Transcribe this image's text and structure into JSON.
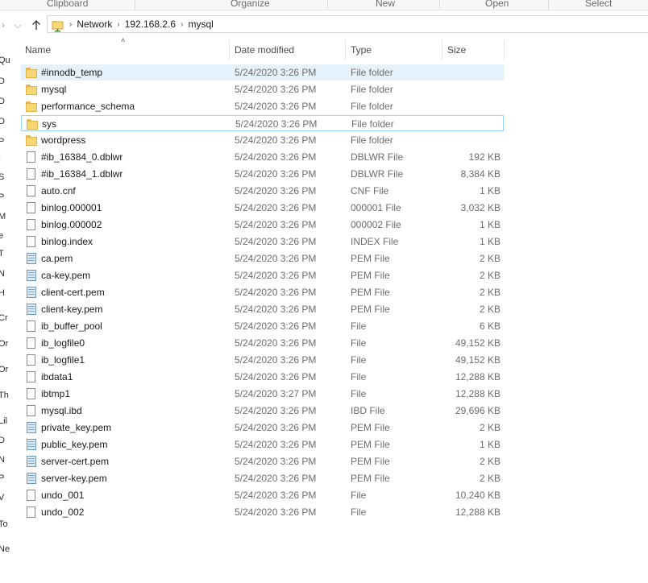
{
  "ribbon": {
    "groups": [
      "Clipboard",
      "Organize",
      "New",
      "Open",
      "Select"
    ]
  },
  "address": {
    "segments": [
      "Network",
      "192.168.2.6",
      "mysql"
    ]
  },
  "nav_pane": {
    "fragments": [
      "Qu",
      "D",
      "D",
      "D",
      "P",
      "I",
      "S",
      "P",
      "M",
      "e",
      "T",
      "N",
      "H",
      "Cr",
      "Or",
      "Or",
      "Th",
      "Lil",
      "D",
      "N",
      "P",
      "V",
      "To",
      "Ne"
    ]
  },
  "columns": {
    "name": "Name",
    "date": "Date modified",
    "type": "Type",
    "size": "Size"
  },
  "files": [
    {
      "name": "#innodb_temp",
      "date": "5/24/2020 3:26 PM",
      "type": "File folder",
      "size": "",
      "icon": "folder-icon"
    },
    {
      "name": "mysql",
      "date": "5/24/2020 3:26 PM",
      "type": "File folder",
      "size": "",
      "icon": "folder-icon"
    },
    {
      "name": "performance_schema",
      "date": "5/24/2020 3:26 PM",
      "type": "File folder",
      "size": "",
      "icon": "folder-icon"
    },
    {
      "name": "sys",
      "date": "5/24/2020 3:26 PM",
      "type": "File folder",
      "size": "",
      "icon": "folder-icon"
    },
    {
      "name": "wordpress",
      "date": "5/24/2020 3:26 PM",
      "type": "File folder",
      "size": "",
      "icon": "folder-icon"
    },
    {
      "name": "#ib_16384_0.dblwr",
      "date": "5/24/2020 3:26 PM",
      "type": "DBLWR File",
      "size": "192 KB",
      "icon": "file-icon"
    },
    {
      "name": "#ib_16384_1.dblwr",
      "date": "5/24/2020 3:26 PM",
      "type": "DBLWR File",
      "size": "8,384 KB",
      "icon": "file-icon"
    },
    {
      "name": "auto.cnf",
      "date": "5/24/2020 3:26 PM",
      "type": "CNF File",
      "size": "1 KB",
      "icon": "file-icon"
    },
    {
      "name": "binlog.000001",
      "date": "5/24/2020 3:26 PM",
      "type": "000001 File",
      "size": "3,032 KB",
      "icon": "file-icon"
    },
    {
      "name": "binlog.000002",
      "date": "5/24/2020 3:26 PM",
      "type": "000002 File",
      "size": "1 KB",
      "icon": "file-icon"
    },
    {
      "name": "binlog.index",
      "date": "5/24/2020 3:26 PM",
      "type": "INDEX File",
      "size": "1 KB",
      "icon": "file-icon"
    },
    {
      "name": "ca.pem",
      "date": "5/24/2020 3:26 PM",
      "type": "PEM File",
      "size": "2 KB",
      "icon": "certificate-icon"
    },
    {
      "name": "ca-key.pem",
      "date": "5/24/2020 3:26 PM",
      "type": "PEM File",
      "size": "2 KB",
      "icon": "certificate-icon"
    },
    {
      "name": "client-cert.pem",
      "date": "5/24/2020 3:26 PM",
      "type": "PEM File",
      "size": "2 KB",
      "icon": "certificate-icon"
    },
    {
      "name": "client-key.pem",
      "date": "5/24/2020 3:26 PM",
      "type": "PEM File",
      "size": "2 KB",
      "icon": "certificate-icon"
    },
    {
      "name": "ib_buffer_pool",
      "date": "5/24/2020 3:26 PM",
      "type": "File",
      "size": "6 KB",
      "icon": "file-icon"
    },
    {
      "name": "ib_logfile0",
      "date": "5/24/2020 3:26 PM",
      "type": "File",
      "size": "49,152 KB",
      "icon": "file-icon"
    },
    {
      "name": "ib_logfile1",
      "date": "5/24/2020 3:26 PM",
      "type": "File",
      "size": "49,152 KB",
      "icon": "file-icon"
    },
    {
      "name": "ibdata1",
      "date": "5/24/2020 3:26 PM",
      "type": "File",
      "size": "12,288 KB",
      "icon": "file-icon"
    },
    {
      "name": "ibtmp1",
      "date": "5/24/2020 3:27 PM",
      "type": "File",
      "size": "12,288 KB",
      "icon": "file-icon"
    },
    {
      "name": "mysql.ibd",
      "date": "5/24/2020 3:26 PM",
      "type": "IBD File",
      "size": "29,696 KB",
      "icon": "file-icon"
    },
    {
      "name": "private_key.pem",
      "date": "5/24/2020 3:26 PM",
      "type": "PEM File",
      "size": "2 KB",
      "icon": "certificate-icon"
    },
    {
      "name": "public_key.pem",
      "date": "5/24/2020 3:26 PM",
      "type": "PEM File",
      "size": "1 KB",
      "icon": "certificate-icon"
    },
    {
      "name": "server-cert.pem",
      "date": "5/24/2020 3:26 PM",
      "type": "PEM File",
      "size": "2 KB",
      "icon": "certificate-icon"
    },
    {
      "name": "server-key.pem",
      "date": "5/24/2020 3:26 PM",
      "type": "PEM File",
      "size": "2 KB",
      "icon": "certificate-icon"
    },
    {
      "name": "undo_001",
      "date": "5/24/2020 3:26 PM",
      "type": "File",
      "size": "10,240 KB",
      "icon": "file-icon"
    },
    {
      "name": "undo_002",
      "date": "5/24/2020 3:26 PM",
      "type": "File",
      "size": "12,288 KB",
      "icon": "file-icon"
    }
  ],
  "state": {
    "selected_row": 0,
    "focused_row": 3
  },
  "colors": {
    "selection": "#e5f1fb",
    "focus_border": "#99d1ff",
    "folder": "#f8d775"
  }
}
